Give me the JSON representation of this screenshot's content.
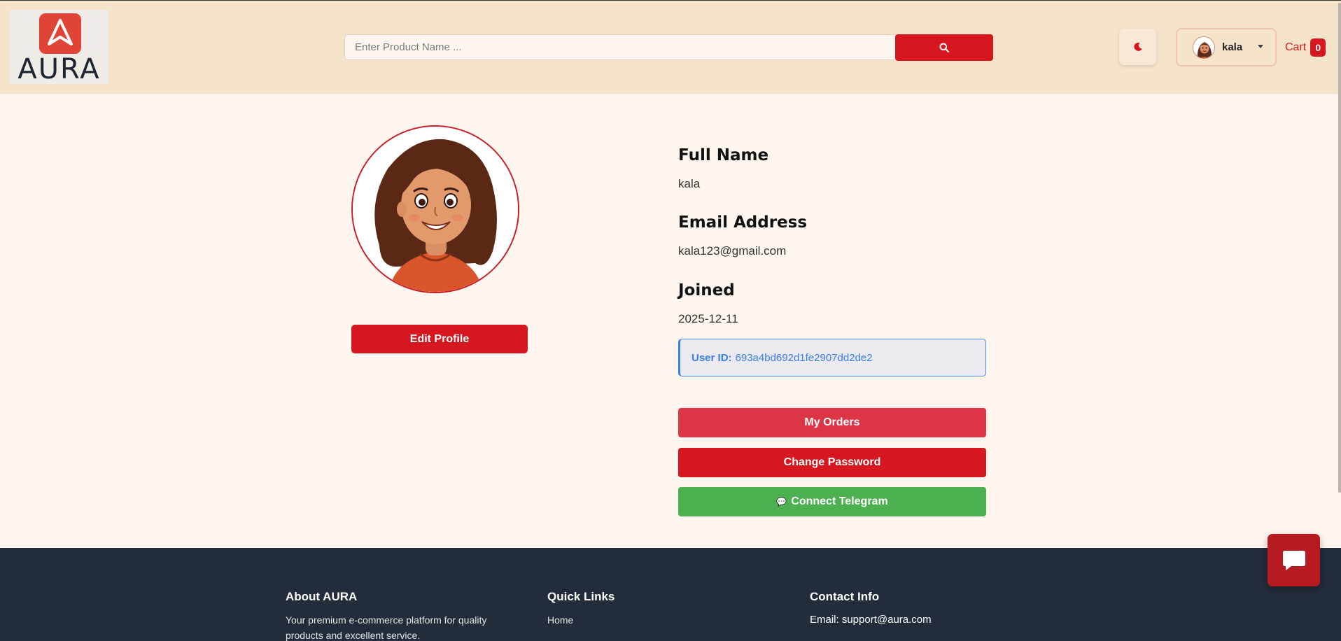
{
  "header": {
    "logo_text": "AURA",
    "search_placeholder": "Enter Product Name ...",
    "search_icon": "search-icon",
    "theme_icon": "moon-icon",
    "user_name": "kala",
    "cart_label": "Cart",
    "cart_count": "0"
  },
  "profile": {
    "edit_button": "Edit Profile",
    "full_name_label": "Full Name",
    "full_name": "kala",
    "email_label": "Email Address",
    "email": "kala123@gmail.com",
    "joined_label": "Joined",
    "joined": "2025-12-11",
    "user_id_label": "User ID:",
    "user_id": "693a4bd692d1fe2907dd2de2"
  },
  "actions": {
    "my_orders": "My Orders",
    "change_password": "Change Password",
    "connect_telegram": "Connect Telegram",
    "telegram_icon": "💬"
  },
  "footer": {
    "about_heading": "About AURA",
    "about_text": "Your premium e-commerce platform for quality products and excellent service.",
    "links_heading": "Quick Links",
    "link_home": "Home",
    "contact_heading": "Contact Info",
    "contact_email": "Email: support@aura.com"
  },
  "colors": {
    "header_bg": "#f5e3ca",
    "page_bg": "#fff6ef",
    "primary_red": "#d6171f",
    "orders_red": "#dc3545",
    "telegram_green": "#4caf50",
    "info_blue": "#3a7de8",
    "footer_bg": "#232c3b"
  },
  "icons": {
    "chat": "chat-bubble-icon",
    "user_avatar": "avatar-icon"
  }
}
